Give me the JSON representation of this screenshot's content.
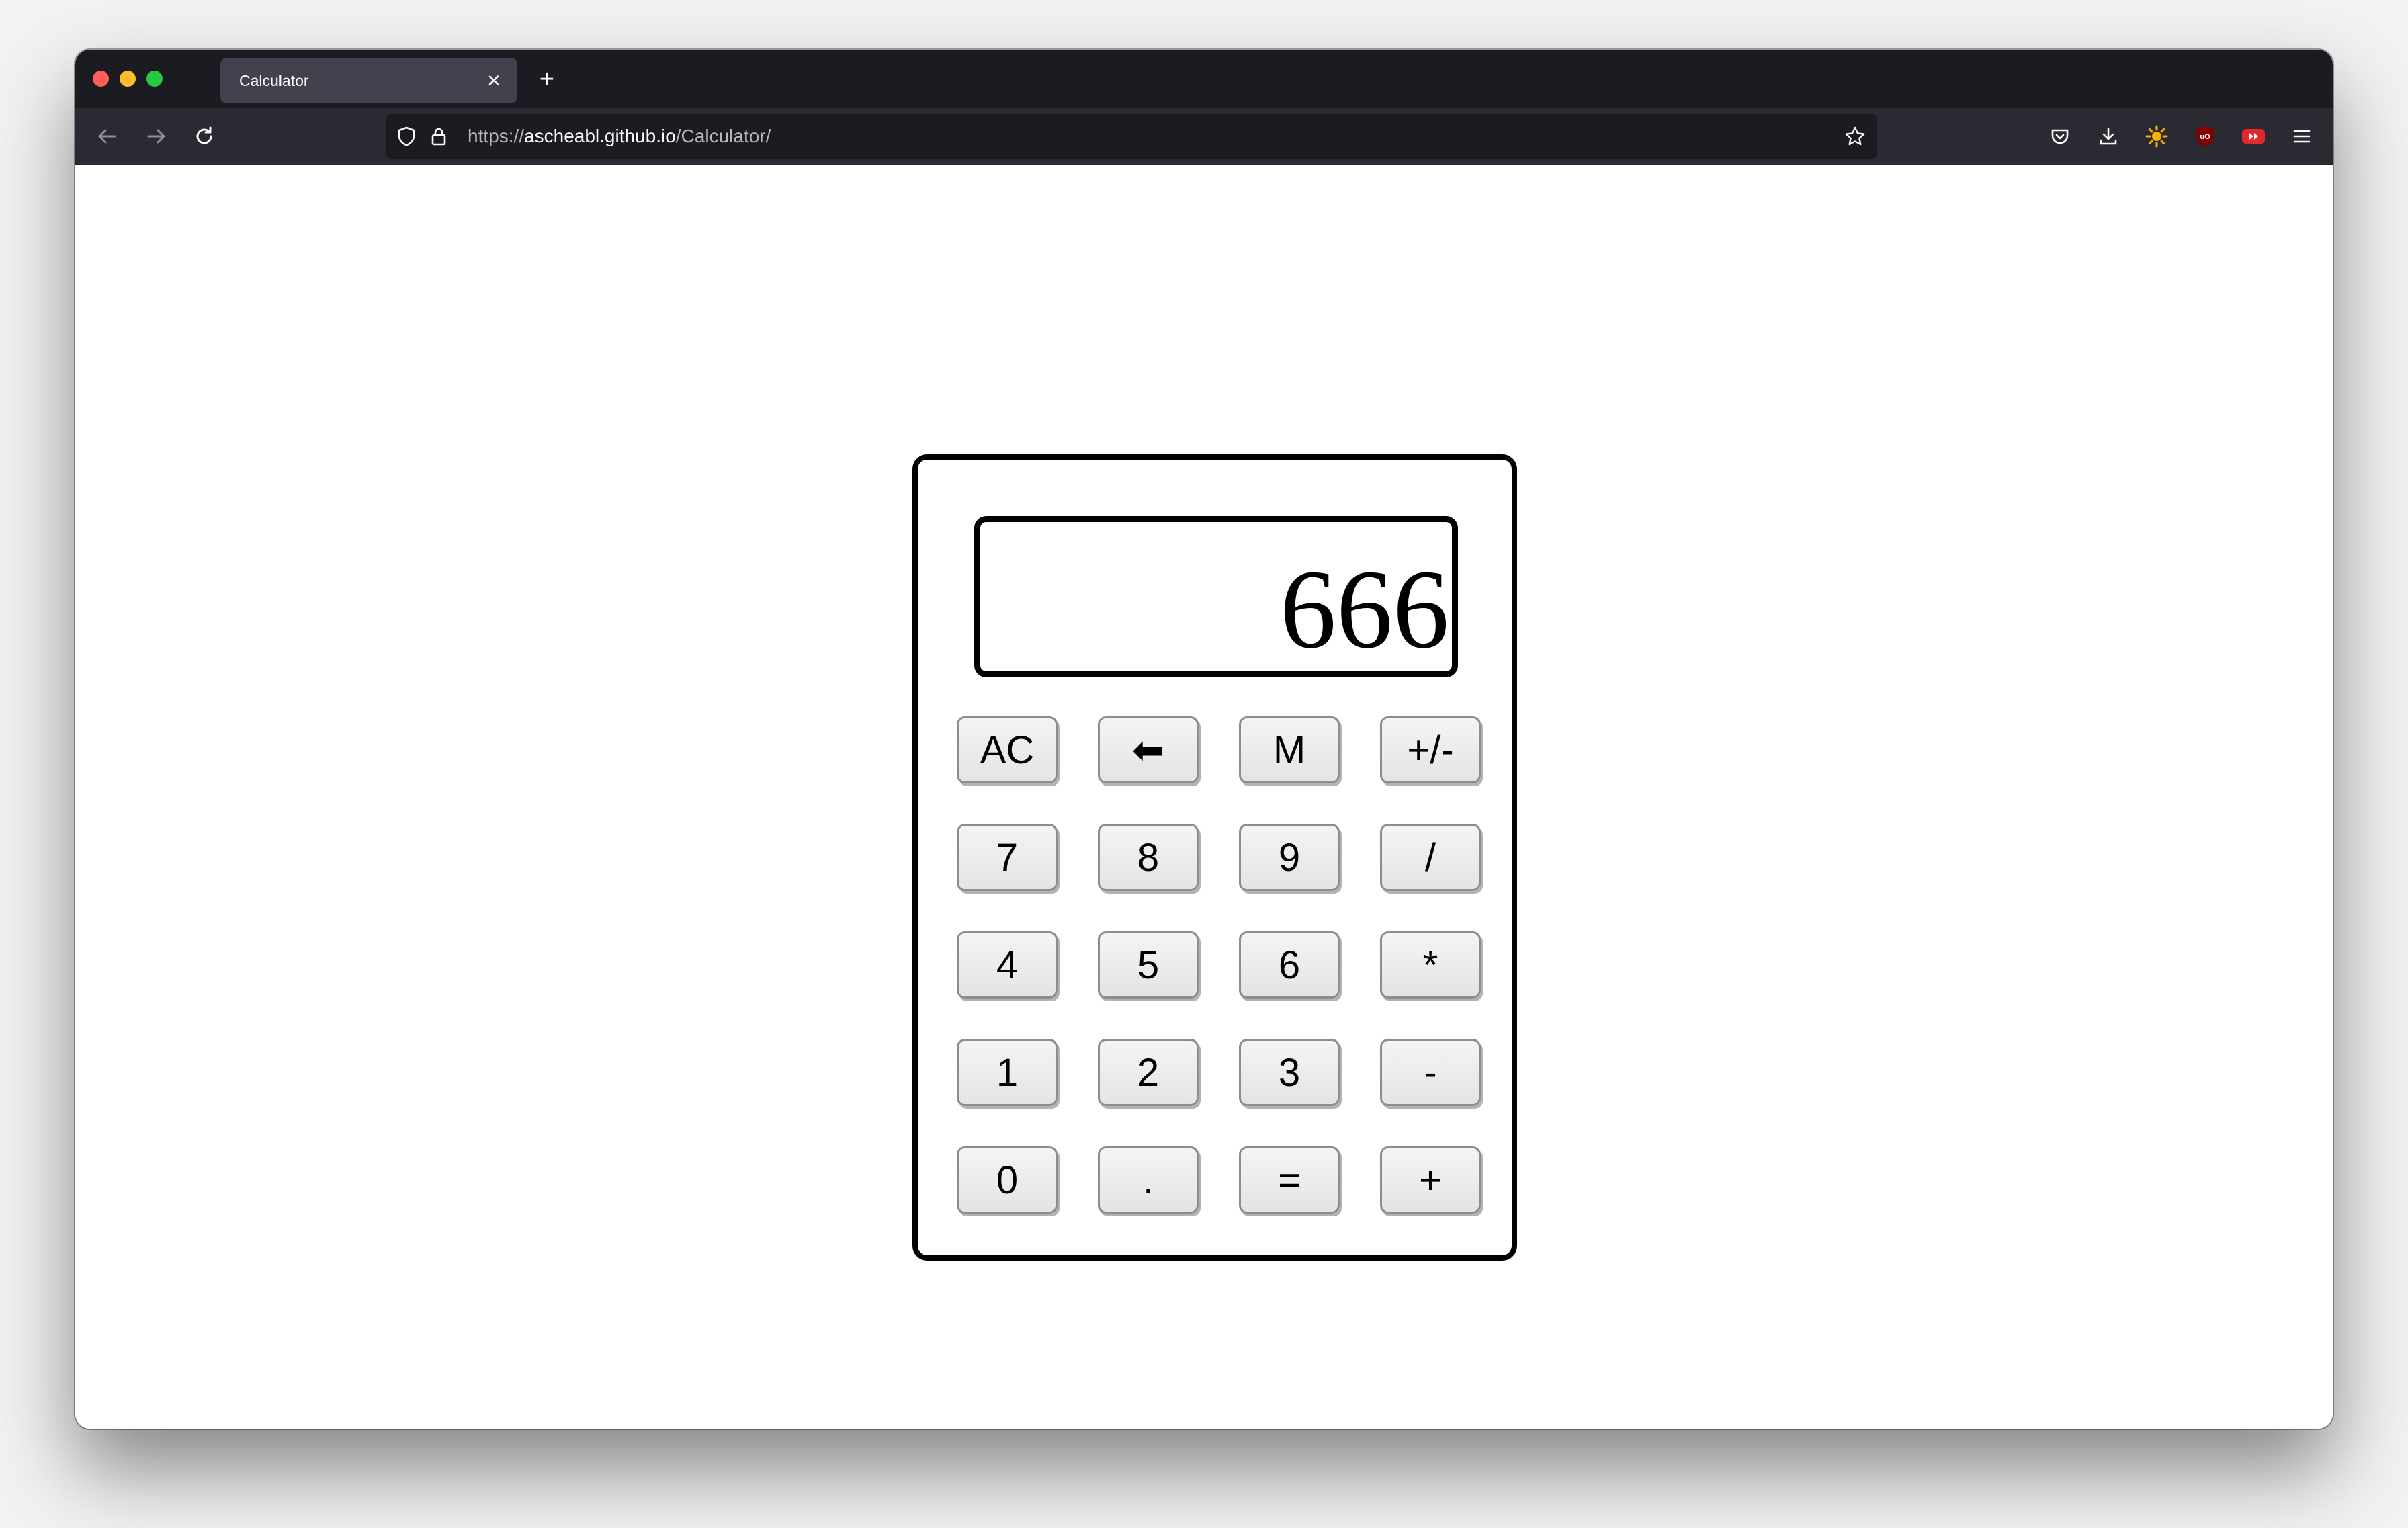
{
  "browser": {
    "tab": {
      "title": "Calculator",
      "close_glyph": "✕"
    },
    "new_tab_glyph": "+",
    "address": {
      "scheme": "https://",
      "host": "ascheabl.github.io",
      "path": "/Calculator/"
    },
    "icons": {
      "back": "arrow-left-icon",
      "forward": "arrow-right-icon",
      "reload": "reload-icon",
      "shield": "tracking-shield-icon",
      "lock": "lock-icon",
      "bookmark": "star-icon",
      "pocket": "pocket-icon",
      "downloads": "download-icon",
      "extension_sun": "sun-extension-icon",
      "extension_ublock": "ublock-icon",
      "extension_video": "video-extension-icon",
      "menu": "hamburger-menu-icon"
    }
  },
  "calculator": {
    "display": "666",
    "keys": [
      [
        "AC",
        "⬅",
        "M",
        "+/-"
      ],
      [
        "7",
        "8",
        "9",
        "/"
      ],
      [
        "4",
        "5",
        "6",
        "*"
      ],
      [
        "1",
        "2",
        "3",
        "-"
      ],
      [
        "0",
        ".",
        "=",
        "+"
      ]
    ]
  },
  "colors": {
    "titlebar": "#1c1b22",
    "navbar": "#2b2a33",
    "tab_active": "#42414d",
    "traffic_close": "#ff5f57",
    "traffic_min": "#febc2e",
    "traffic_max": "#28c840",
    "key_face": "#e8e8e8",
    "key_border": "#8d8d8d"
  }
}
